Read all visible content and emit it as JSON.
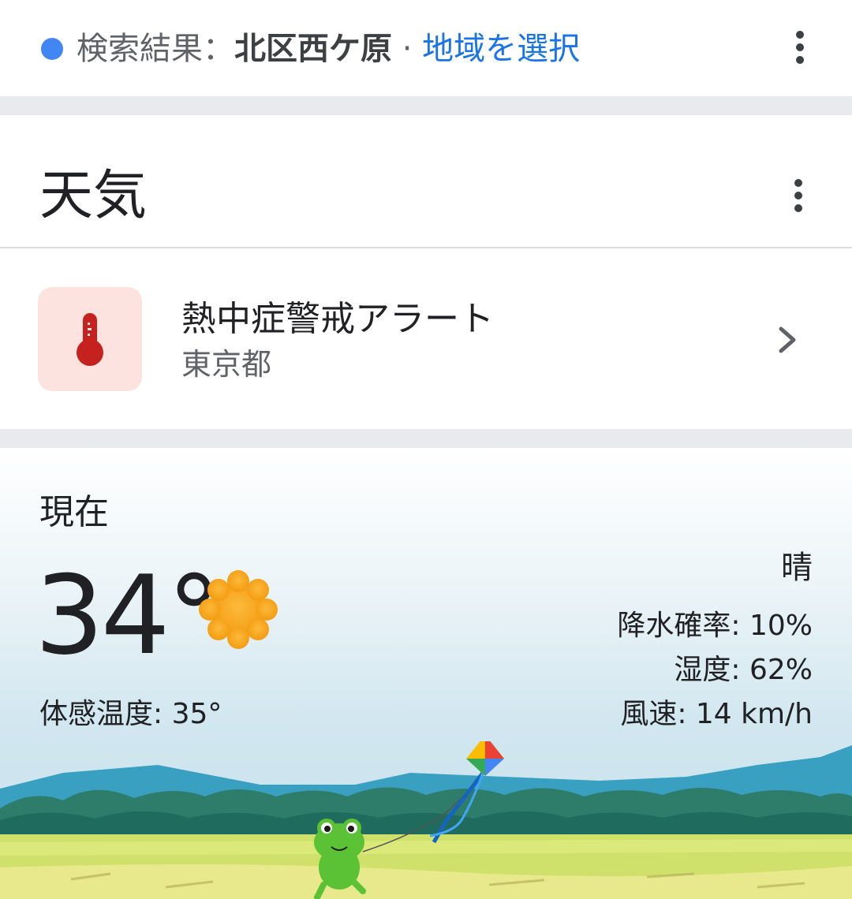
{
  "header": {
    "prefix": "検索結果：",
    "location": "北区西ケ原",
    "separator": " · ",
    "select_region": "地域を選択"
  },
  "title": "天気",
  "alert": {
    "title": "熱中症警戒アラート",
    "region": "東京都",
    "icon": "thermometer-icon"
  },
  "weather": {
    "now_label": "現在",
    "temperature": "34°",
    "condition_icon": "sun-icon",
    "condition": "晴",
    "feels_like": "体感温度: 35°",
    "precipitation": "降水確率: 10%",
    "humidity": "湿度: 62%",
    "wind": "風速: 14 km/h"
  },
  "colors": {
    "accent_blue": "#1a73e8",
    "location_dot": "#4285f4",
    "alert_bg": "#fde3e0",
    "alert_icon": "#c5221f",
    "sun": "#f9a825"
  }
}
